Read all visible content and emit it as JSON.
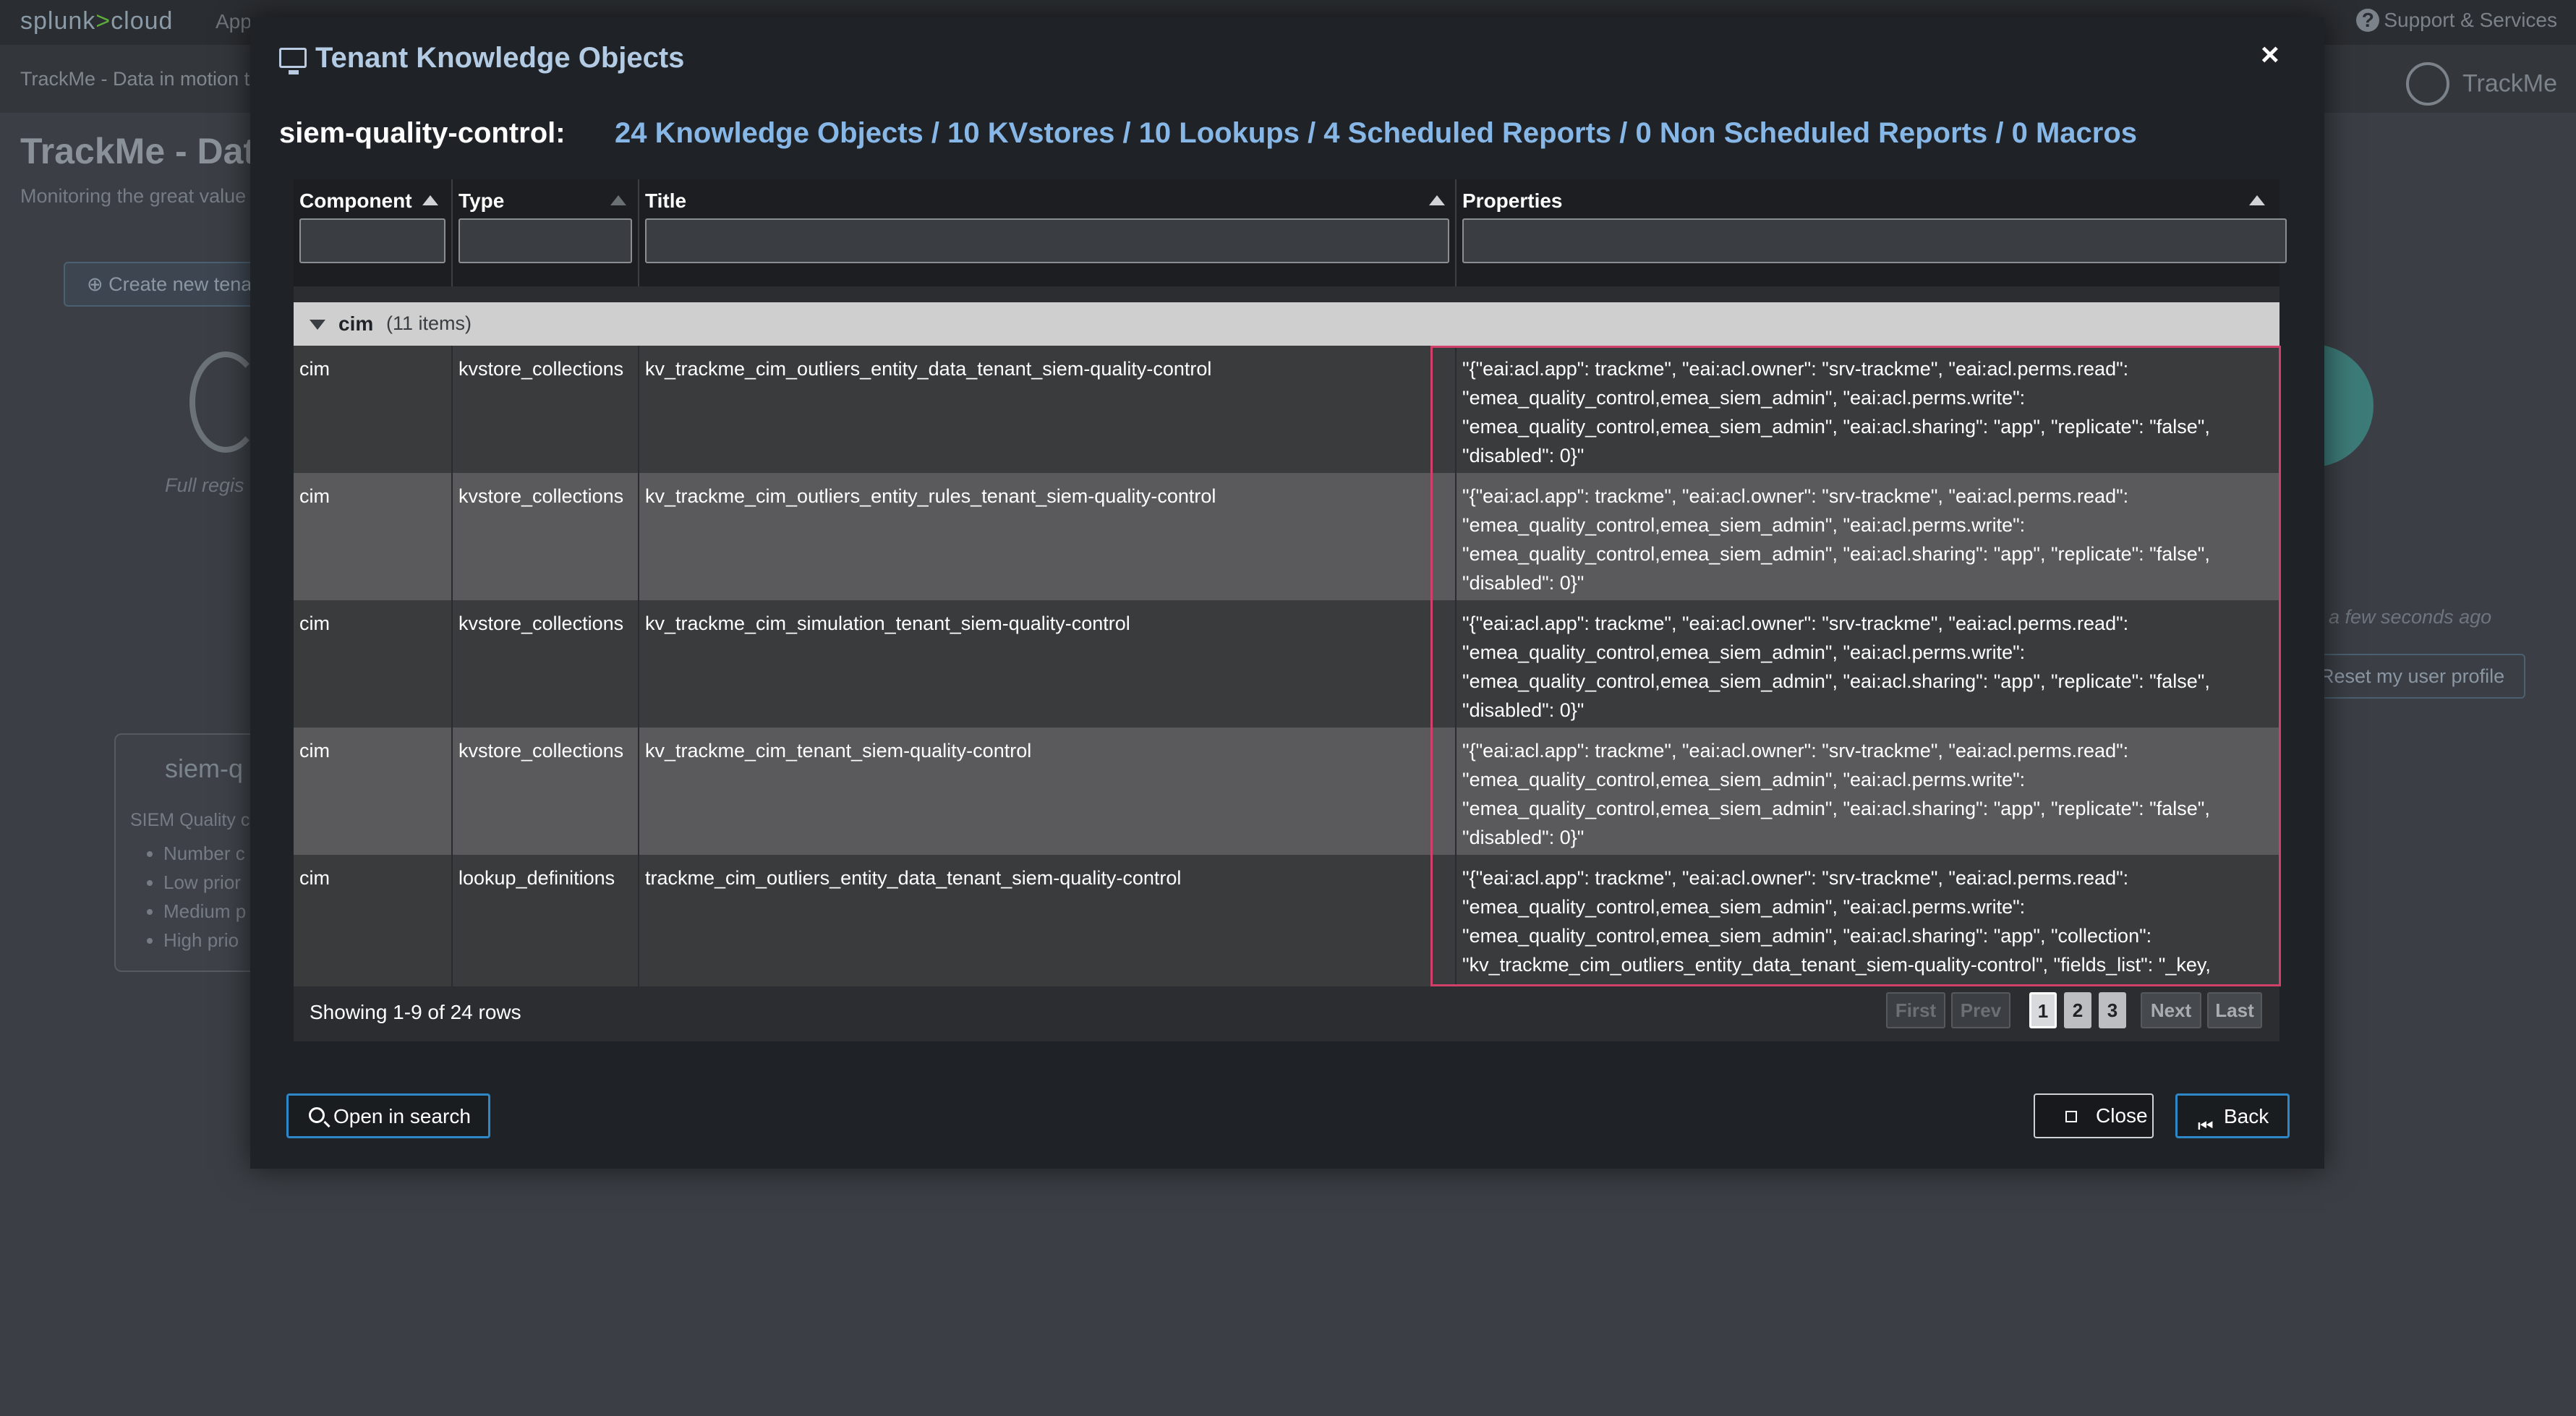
{
  "background": {
    "logo_main": "splunk",
    "logo_gt": ">",
    "logo_cloud": "cloud",
    "nav_apps": "Apps",
    "support_label": "Support & Services",
    "subbar_text": "TrackMe - Data in motion t",
    "app_name": "TrackMe",
    "page_title": "TrackMe - Data",
    "page_sub": "Monitoring the great value",
    "create_button": "Create new tena",
    "full_reg": "Full regis",
    "card_title": "siem-q",
    "card_desc": "SIEM Quality c",
    "card_items": [
      "Number c",
      "Low prior",
      "Medium p",
      "High prio"
    ],
    "few_seconds": "a few seconds ago",
    "reset_button": "Reset my user profile"
  },
  "modal": {
    "title": "Tenant Knowledge Objects",
    "close_glyph": "×",
    "tenant_label": "siem-quality-control:",
    "summary": "24 Knowledge Objects / 10 KVstores / 10 Lookups / 4 Scheduled Reports / 0 Non Scheduled Reports / 0 Macros"
  },
  "table": {
    "columns": {
      "component": "Component",
      "type": "Type",
      "title": "Title",
      "properties": "Properties"
    },
    "group": {
      "name": "cim",
      "count": "(11 items)"
    },
    "rows": [
      {
        "component": "cim",
        "type": "kvstore_collections",
        "title": "kv_trackme_cim_outliers_entity_data_tenant_siem-quality-control",
        "properties": "\"{\"eai:acl.app\": trackme\", \"eai:acl.owner\": \"srv-trackme\", \"eai:acl.perms.read\": \"emea_quality_control,emea_siem_admin\", \"eai:acl.perms.write\": \"emea_quality_control,emea_siem_admin\", \"eai:acl.sharing\": \"app\", \"replicate\": \"false\", \"disabled\": 0}\""
      },
      {
        "component": "cim",
        "type": "kvstore_collections",
        "title": "kv_trackme_cim_outliers_entity_rules_tenant_siem-quality-control",
        "properties": "\"{\"eai:acl.app\": trackme\", \"eai:acl.owner\": \"srv-trackme\", \"eai:acl.perms.read\": \"emea_quality_control,emea_siem_admin\", \"eai:acl.perms.write\": \"emea_quality_control,emea_siem_admin\", \"eai:acl.sharing\": \"app\", \"replicate\": \"false\", \"disabled\": 0}\""
      },
      {
        "component": "cim",
        "type": "kvstore_collections",
        "title": "kv_trackme_cim_simulation_tenant_siem-quality-control",
        "properties": "\"{\"eai:acl.app\": trackme\", \"eai:acl.owner\": \"srv-trackme\", \"eai:acl.perms.read\": \"emea_quality_control,emea_siem_admin\", \"eai:acl.perms.write\": \"emea_quality_control,emea_siem_admin\", \"eai:acl.sharing\": \"app\", \"replicate\": \"false\", \"disabled\": 0}\""
      },
      {
        "component": "cim",
        "type": "kvstore_collections",
        "title": "kv_trackme_cim_tenant_siem-quality-control",
        "properties": "\"{\"eai:acl.app\": trackme\", \"eai:acl.owner\": \"srv-trackme\", \"eai:acl.perms.read\": \"emea_quality_control,emea_siem_admin\", \"eai:acl.perms.write\": \"emea_quality_control,emea_siem_admin\", \"eai:acl.sharing\": \"app\", \"replicate\": \"false\", \"disabled\": 0}\""
      },
      {
        "component": "cim",
        "type": "lookup_definitions",
        "title": "trackme_cim_outliers_entity_data_tenant_siem-quality-control",
        "properties": "\"{\"eai:acl.app\": trackme\", \"eai:acl.owner\": \"srv-trackme\", \"eai:acl.perms.read\": \"emea_quality_control,emea_siem_admin\", \"eai:acl.perms.write\": \"emea_quality_control,emea_siem_admin\", \"eai:acl.sharing\": \"app\", \"collection\": \"kv_trackme_cim_outliers_entity_data_tenant_siem-quality-control\", \"fields_list\": \"_key, object_category, object, entity, cim_field, mtime, isOutlier, isOutlierReason,"
      }
    ],
    "footer": {
      "showing": "Showing 1-9 of 24 rows",
      "first": "First",
      "prev": "Prev",
      "pages": [
        "1",
        "2",
        "3"
      ],
      "next": "Next",
      "last": "Last"
    }
  },
  "buttons": {
    "open_in_search": "Open in search",
    "close": "Close",
    "back": "Back"
  }
}
